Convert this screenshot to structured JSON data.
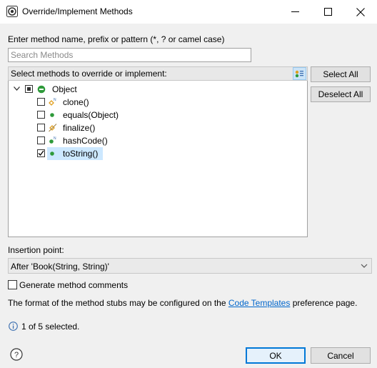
{
  "window": {
    "title": "Override/Implement Methods",
    "minimize_icon": "minimize-icon",
    "maximize_icon": "maximize-icon",
    "close_icon": "close-icon"
  },
  "filter": {
    "label": "Enter method name, prefix or pattern (*, ? or camel case)",
    "placeholder": "Search Methods",
    "value": ""
  },
  "methods": {
    "header": "Select methods to override or implement:",
    "root": {
      "label": "Object",
      "expanded": true,
      "state": "partial"
    },
    "items": [
      {
        "label": "clone()",
        "checked": false,
        "icon": "protected-native-method-icon"
      },
      {
        "label": "equals(Object)",
        "checked": false,
        "icon": "public-method-icon"
      },
      {
        "label": "finalize()",
        "checked": false,
        "icon": "protected-deprecated-method-icon"
      },
      {
        "label": "hashCode()",
        "checked": false,
        "icon": "public-native-method-icon"
      },
      {
        "label": "toString()",
        "checked": true,
        "icon": "public-method-icon",
        "selected": true
      }
    ]
  },
  "buttons": {
    "select_all": "Select All",
    "deselect_all": "Deselect All",
    "ok": "OK",
    "cancel": "Cancel"
  },
  "insertion": {
    "label": "Insertion point:",
    "value": "After 'Book(String, String)'"
  },
  "options": {
    "generate_comments": "Generate method comments",
    "generate_comments_checked": false
  },
  "info": {
    "prefix": "The format of the method stubs may be configured on the",
    "link": "Code Templates",
    "suffix": "preference page.",
    "status": "1 of 5 selected."
  },
  "colors": {
    "accent": "#0078d7",
    "selection": "#cce8ff",
    "public_method": "#2e9a3a",
    "protected_method": "#e0a020",
    "link": "#0066cc"
  }
}
